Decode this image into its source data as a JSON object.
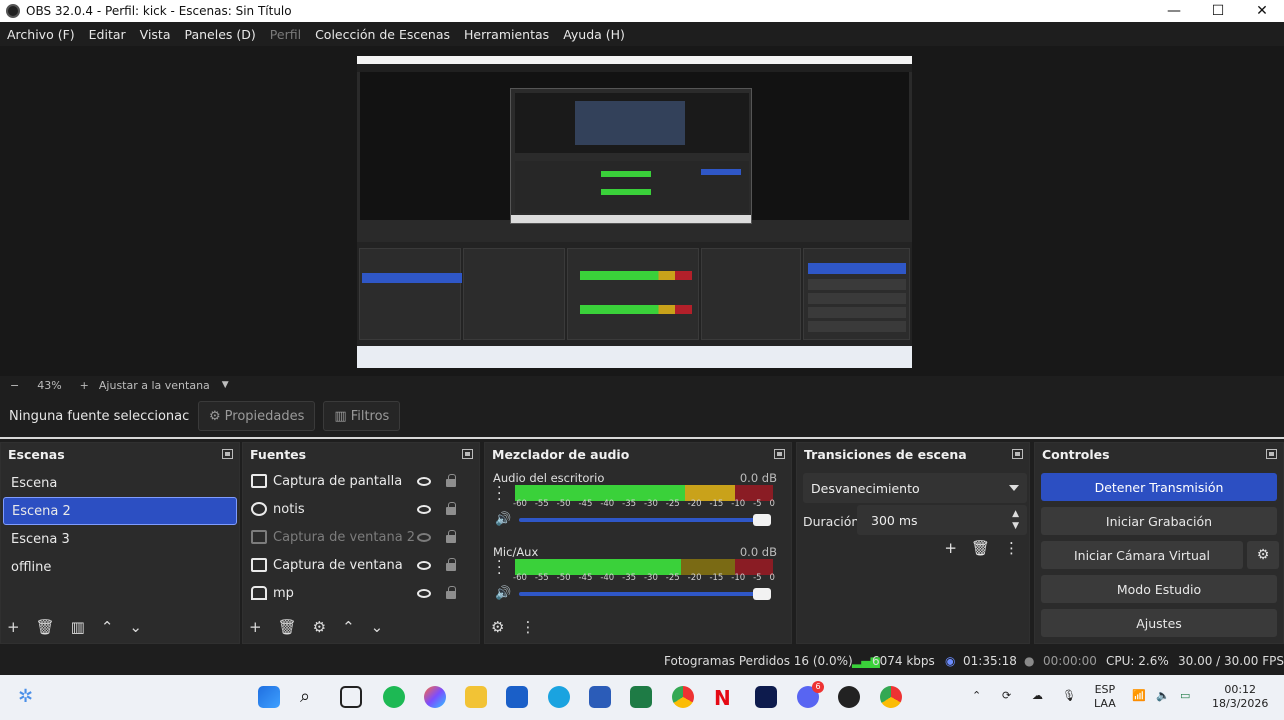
{
  "window": {
    "title": "OBS 32.0.4 - Perfil: kick - Escenas: Sin Título",
    "minimize": "—",
    "maximize": "☐",
    "close": "✕"
  },
  "menu": [
    "Archivo (F)",
    "Editar",
    "Vista",
    "Paneles (D)",
    "Perfil",
    "Colección de Escenas",
    "Herramientas",
    "Ayuda (H)"
  ],
  "zoom": {
    "minus": "−",
    "value": "43%",
    "plus": "+",
    "fit": "Ajustar a la ventana"
  },
  "source_bar": {
    "no_source": "Ninguna fuente seleccionac",
    "properties": "Propiedades",
    "filters": "Filtros"
  },
  "scenes": {
    "title": "Escenas",
    "items": [
      "Escena",
      "Escena 2",
      "Escena 3",
      "offline"
    ],
    "selected": "Escena 2"
  },
  "sources": {
    "title": "Fuentes",
    "items": [
      "Captura de pantalla",
      "notis",
      "Captura de ventana 2",
      "Captura de ventana",
      "mp"
    ]
  },
  "mixer": {
    "title": "Mezclador de audio",
    "channels": [
      {
        "name": "Audio del escritorio",
        "db": "0.0 dB"
      },
      {
        "name": "Mic/Aux",
        "db": "0.0 dB"
      }
    ],
    "ticks": [
      "-60",
      "-55",
      "-50",
      "-45",
      "-40",
      "-35",
      "-30",
      "-25",
      "-20",
      "-15",
      "-10",
      "-5",
      "0"
    ]
  },
  "transitions": {
    "title": "Transiciones de escena",
    "selected": "Desvanecimiento",
    "duration_label": "Duración",
    "duration_value": "300 ms"
  },
  "controls": {
    "title": "Controles",
    "stop_stream": "Detener Transmisión",
    "start_recording": "Iniciar Grabación",
    "start_virtual_cam": "Iniciar Cámara Virtual",
    "studio_mode": "Modo Estudio",
    "settings": "Ajustes"
  },
  "status": {
    "dropped_frames": "Fotogramas Perdidos 16 (0.0%)",
    "bitrate": "6074 kbps",
    "stream_time": "01:35:18",
    "rec_time": "00:00:00",
    "cpu": "CPU: 2.6%",
    "fps": "30.00 / 30.00 FPS"
  },
  "taskbar": {
    "lang": "ESP",
    "lang2": "LAA",
    "time": "00:12",
    "date": "18/3/2026",
    "discord_badge": "6"
  },
  "colors": {
    "accent": "#2c4fc2",
    "meter_green": "#3ad13a",
    "meter_yellow": "#c9a21a",
    "meter_red": "#b3202a"
  }
}
